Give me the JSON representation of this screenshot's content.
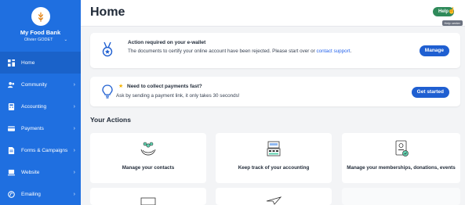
{
  "sidebar": {
    "brand_name": "My Food Bank",
    "user_name": "Olivier GODET",
    "items": [
      {
        "label": "Home",
        "icon": "dashboard-icon"
      },
      {
        "label": "Community",
        "icon": "community-icon"
      },
      {
        "label": "Accounting",
        "icon": "accounting-icon"
      },
      {
        "label": "Payments",
        "icon": "payments-icon"
      },
      {
        "label": "Forms & Campaigns",
        "icon": "forms-icon"
      },
      {
        "label": "Website",
        "icon": "website-icon"
      },
      {
        "label": "Emailing",
        "icon": "emailing-icon"
      }
    ]
  },
  "header": {
    "title": "Home",
    "help_label": "Help",
    "help_tooltip": "Help center"
  },
  "alerts": {
    "ewallet": {
      "title": "Action required on your e-wallet",
      "text": "The documents to certify your online account have been rejected. Please start over or ",
      "link": "contact support",
      "end": ".",
      "button": "Manage"
    },
    "payments": {
      "title": "Need to collect payments fast?",
      "text": "Ask by sending a payment link, it only takes 30 seconds!",
      "button": "Get started"
    }
  },
  "actions": {
    "title": "Your Actions",
    "items": [
      {
        "label": "Manage your contacts"
      },
      {
        "label": "Keep track of your accounting"
      },
      {
        "label": "Manage your memberships, donations, events"
      }
    ]
  },
  "colors": {
    "sidebar": "#1f6fe0",
    "primary_button": "#1f5fd1",
    "help_button": "#2f8a5a"
  }
}
